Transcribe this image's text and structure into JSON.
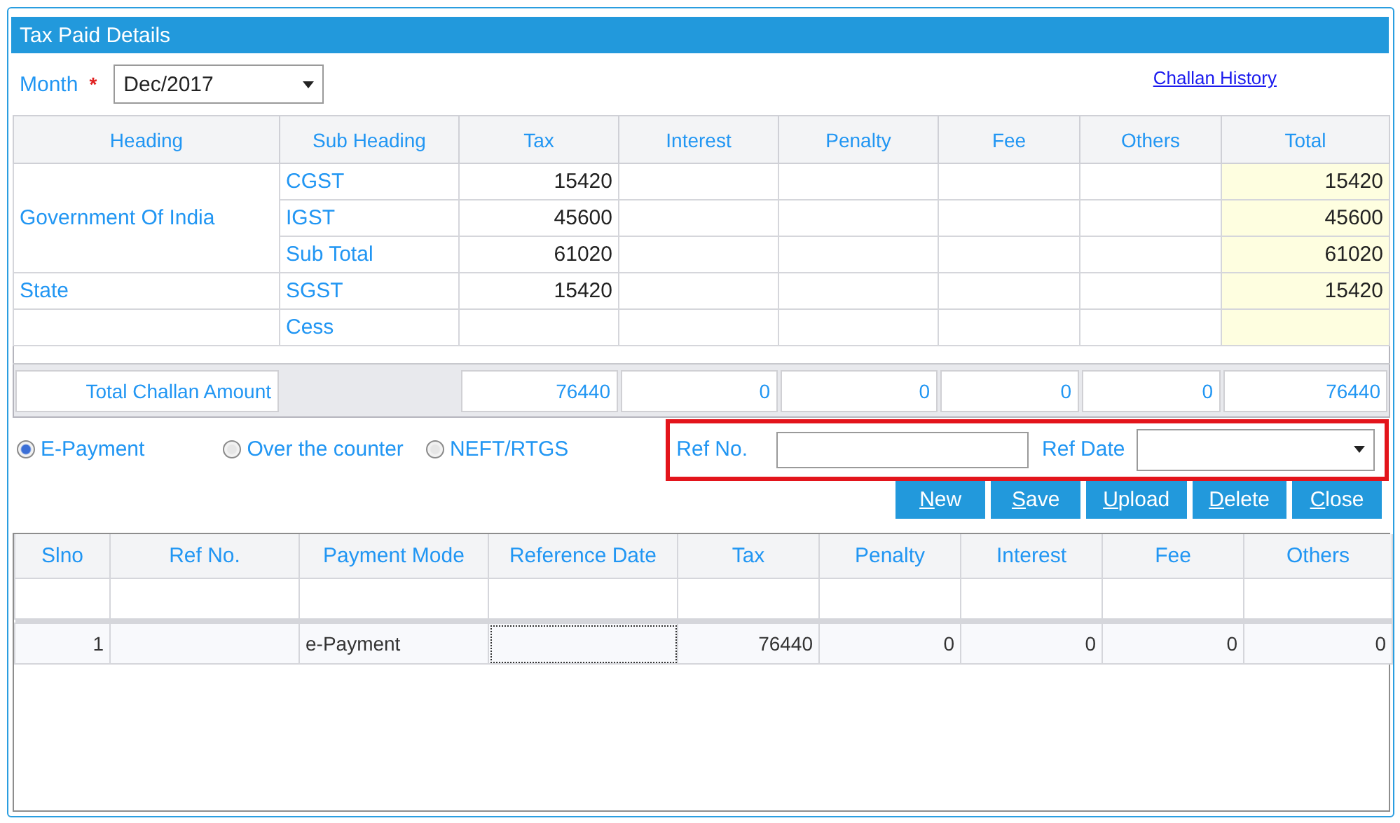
{
  "panel": {
    "title": "Tax Paid Details"
  },
  "month": {
    "label": "Month",
    "required_mark": "*",
    "value": "Dec/2017"
  },
  "challan_history_link": "Challan History",
  "tax_table": {
    "columns": [
      {
        "label": "Heading",
        "highlighted": false
      },
      {
        "label": "Sub Heading",
        "highlighted": false
      },
      {
        "label": "Tax",
        "highlighted": false
      },
      {
        "label": "Interest",
        "highlighted": false
      },
      {
        "label": "Penalty",
        "highlighted": false
      },
      {
        "label": "Fee",
        "highlighted": false
      },
      {
        "label": "Others",
        "highlighted": false
      },
      {
        "label": "Total",
        "highlighted": true
      }
    ],
    "groups": [
      {
        "heading": "Government Of India",
        "rows": [
          {
            "sub_heading": "CGST",
            "cells": [
              {
                "text": "15420"
              },
              {},
              {},
              {},
              {},
              {
                "text": "15420"
              }
            ]
          },
          {
            "sub_heading": "IGST",
            "cells": [
              {
                "text": "45600"
              },
              {},
              {},
              {},
              {},
              {
                "text": "45600"
              }
            ]
          },
          {
            "sub_heading": "Sub Total",
            "cells": [
              {
                "text": "61020"
              },
              {},
              {},
              {},
              {},
              {
                "text": "61020"
              }
            ]
          }
        ]
      },
      {
        "heading": "State",
        "rows": [
          {
            "sub_heading": "SGST",
            "cells": [
              {
                "text": "15420"
              },
              {},
              {},
              {},
              {},
              {
                "text": "15420"
              }
            ]
          }
        ]
      },
      {
        "rows": [
          {
            "sub_heading": "Cess",
            "cells": [
              {},
              {},
              {},
              {},
              {},
              {}
            ]
          }
        ]
      }
    ],
    "total_row": {
      "label": "Total Challan Amount",
      "values": [
        "76440",
        "0",
        "0",
        "0",
        "0",
        "76440"
      ]
    }
  },
  "payment_modes": [
    {
      "label": "E-Payment",
      "selected": true
    },
    {
      "label": "Over the counter",
      "selected": false
    },
    {
      "label": "NEFT/RTGS",
      "selected": false
    }
  ],
  "ref_no": {
    "label": "Ref No."
  },
  "ref_date": {
    "label": "Ref Date"
  },
  "buttons": [
    "New",
    "Save",
    "Upload",
    "Delete",
    "Close"
  ],
  "payments_table": {
    "columns": [
      "Slno",
      "Ref No.",
      "Payment Mode",
      "Reference Date",
      "Tax",
      "Penalty",
      "Interest",
      "Fee",
      "Others"
    ],
    "rows": [
      {
        "cells": [
          {
            "text": "1",
            "focused": false
          },
          {
            "focused": false
          },
          {
            "text": "e-Payment",
            "focused": false
          },
          {
            "focused": true
          },
          {
            "text": "76440",
            "focused": false
          },
          {
            "text": "0",
            "focused": false
          },
          {
            "text": "0",
            "focused": false
          },
          {
            "text": "0",
            "focused": false
          },
          {
            "text": "0",
            "focused": false
          }
        ]
      }
    ]
  }
}
